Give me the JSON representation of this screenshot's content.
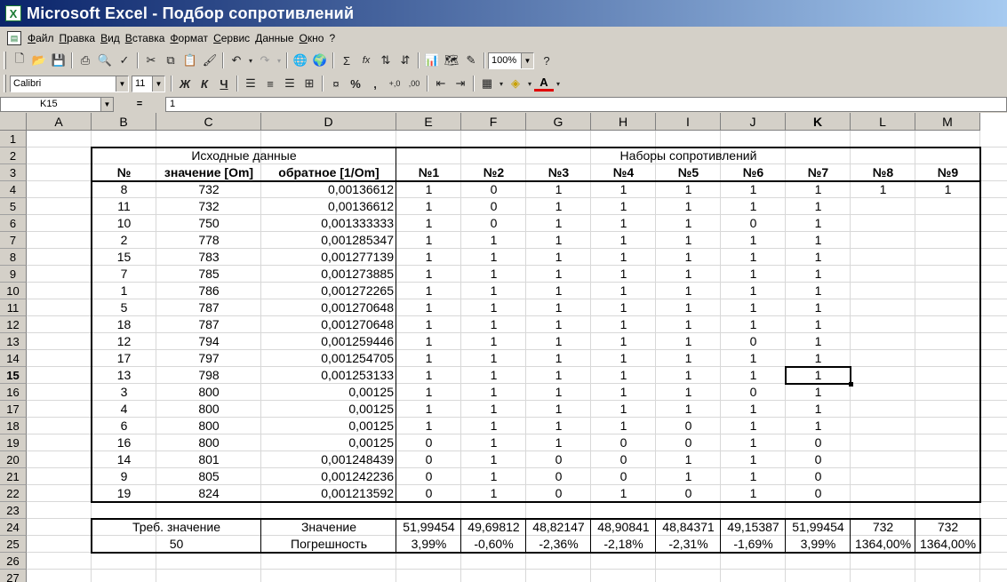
{
  "window": {
    "app_icon": "excel-icon",
    "title": "Microsoft Excel - Подбор сопротивлений"
  },
  "menu": {
    "items": [
      "Файл",
      "Правка",
      "Вид",
      "Вставка",
      "Формат",
      "Сервис",
      "Данные",
      "Окно",
      "?"
    ]
  },
  "toolbar": {
    "zoom": "100%",
    "font_name": "Calibri",
    "font_size": "11",
    "bold_label": "Ж",
    "italic_label": "К",
    "underline_label": "Ч",
    "sum_label": "Σ",
    "fx_label": "fx",
    "percent_label": "%",
    "comma_label": ",",
    "inc_dec_label": "+,0",
    "dec_dec_label": ",00",
    "font_color_label": "A"
  },
  "formula_bar": {
    "cell_ref": "K15",
    "equals": "=",
    "value": "1"
  },
  "sheet": {
    "columns": [
      "A",
      "B",
      "C",
      "D",
      "E",
      "F",
      "G",
      "H",
      "I",
      "J",
      "K",
      "L",
      "M"
    ],
    "rows": [
      "1",
      "2",
      "3",
      "4",
      "5",
      "6",
      "7",
      "8",
      "9",
      "10",
      "11",
      "12",
      "13",
      "14",
      "15",
      "16",
      "17",
      "18",
      "19",
      "20",
      "21",
      "22",
      "23",
      "24",
      "25",
      "26",
      "27"
    ],
    "active_col": "K",
    "active_row": "15",
    "header_source": "Исходные данные",
    "header_sets": "Наборы сопротивлений",
    "col_headers": [
      "№",
      "значение [Om]",
      "обратное [1/Om]"
    ],
    "set_headers": [
      "№1",
      "№2",
      "№3",
      "№4",
      "№5",
      "№6",
      "№7",
      "№8",
      "№9"
    ],
    "data_rows": [
      {
        "n": "8",
        "val": "732",
        "inv": "0,00136612",
        "sets": [
          "1",
          "0",
          "1",
          "1",
          "1",
          "1",
          "1",
          "1",
          "1"
        ]
      },
      {
        "n": "11",
        "val": "732",
        "inv": "0,00136612",
        "sets": [
          "1",
          "0",
          "1",
          "1",
          "1",
          "1",
          "1",
          "",
          ""
        ]
      },
      {
        "n": "10",
        "val": "750",
        "inv": "0,001333333",
        "sets": [
          "1",
          "0",
          "1",
          "1",
          "1",
          "0",
          "1",
          "",
          ""
        ]
      },
      {
        "n": "2",
        "val": "778",
        "inv": "0,001285347",
        "sets": [
          "1",
          "1",
          "1",
          "1",
          "1",
          "1",
          "1",
          "",
          ""
        ]
      },
      {
        "n": "15",
        "val": "783",
        "inv": "0,001277139",
        "sets": [
          "1",
          "1",
          "1",
          "1",
          "1",
          "1",
          "1",
          "",
          ""
        ]
      },
      {
        "n": "7",
        "val": "785",
        "inv": "0,001273885",
        "sets": [
          "1",
          "1",
          "1",
          "1",
          "1",
          "1",
          "1",
          "",
          ""
        ]
      },
      {
        "n": "1",
        "val": "786",
        "inv": "0,001272265",
        "sets": [
          "1",
          "1",
          "1",
          "1",
          "1",
          "1",
          "1",
          "",
          ""
        ]
      },
      {
        "n": "5",
        "val": "787",
        "inv": "0,001270648",
        "sets": [
          "1",
          "1",
          "1",
          "1",
          "1",
          "1",
          "1",
          "",
          ""
        ]
      },
      {
        "n": "18",
        "val": "787",
        "inv": "0,001270648",
        "sets": [
          "1",
          "1",
          "1",
          "1",
          "1",
          "1",
          "1",
          "",
          ""
        ]
      },
      {
        "n": "12",
        "val": "794",
        "inv": "0,001259446",
        "sets": [
          "1",
          "1",
          "1",
          "1",
          "1",
          "0",
          "1",
          "",
          ""
        ]
      },
      {
        "n": "17",
        "val": "797",
        "inv": "0,001254705",
        "sets": [
          "1",
          "1",
          "1",
          "1",
          "1",
          "1",
          "1",
          "",
          ""
        ]
      },
      {
        "n": "13",
        "val": "798",
        "inv": "0,001253133",
        "sets": [
          "1",
          "1",
          "1",
          "1",
          "1",
          "1",
          "1",
          "",
          ""
        ]
      },
      {
        "n": "3",
        "val": "800",
        "inv": "0,00125",
        "sets": [
          "1",
          "1",
          "1",
          "1",
          "1",
          "0",
          "1",
          "",
          ""
        ]
      },
      {
        "n": "4",
        "val": "800",
        "inv": "0,00125",
        "sets": [
          "1",
          "1",
          "1",
          "1",
          "1",
          "1",
          "1",
          "",
          ""
        ]
      },
      {
        "n": "6",
        "val": "800",
        "inv": "0,00125",
        "sets": [
          "1",
          "1",
          "1",
          "1",
          "0",
          "1",
          "1",
          "",
          ""
        ]
      },
      {
        "n": "16",
        "val": "800",
        "inv": "0,00125",
        "sets": [
          "0",
          "1",
          "1",
          "0",
          "0",
          "1",
          "0",
          "",
          ""
        ]
      },
      {
        "n": "14",
        "val": "801",
        "inv": "0,001248439",
        "sets": [
          "0",
          "1",
          "0",
          "0",
          "1",
          "1",
          "0",
          "",
          ""
        ]
      },
      {
        "n": "9",
        "val": "805",
        "inv": "0,001242236",
        "sets": [
          "0",
          "1",
          "0",
          "0",
          "1",
          "1",
          "0",
          "",
          ""
        ]
      },
      {
        "n": "19",
        "val": "824",
        "inv": "0,001213592",
        "sets": [
          "0",
          "1",
          "0",
          "1",
          "0",
          "1",
          "0",
          "",
          ""
        ]
      }
    ],
    "summary": {
      "req_label": "Треб. значение",
      "req_value": "50",
      "value_label": "Значение",
      "error_label": "Погрешность",
      "values": [
        "51,99454",
        "49,69812",
        "48,82147",
        "48,90841",
        "48,84371",
        "49,15387",
        "51,99454",
        "732",
        "732"
      ],
      "errors": [
        "3,99%",
        "-0,60%",
        "-2,36%",
        "-2,18%",
        "-2,31%",
        "-1,69%",
        "3,99%",
        "1364,00%",
        "1364,00%"
      ]
    }
  }
}
